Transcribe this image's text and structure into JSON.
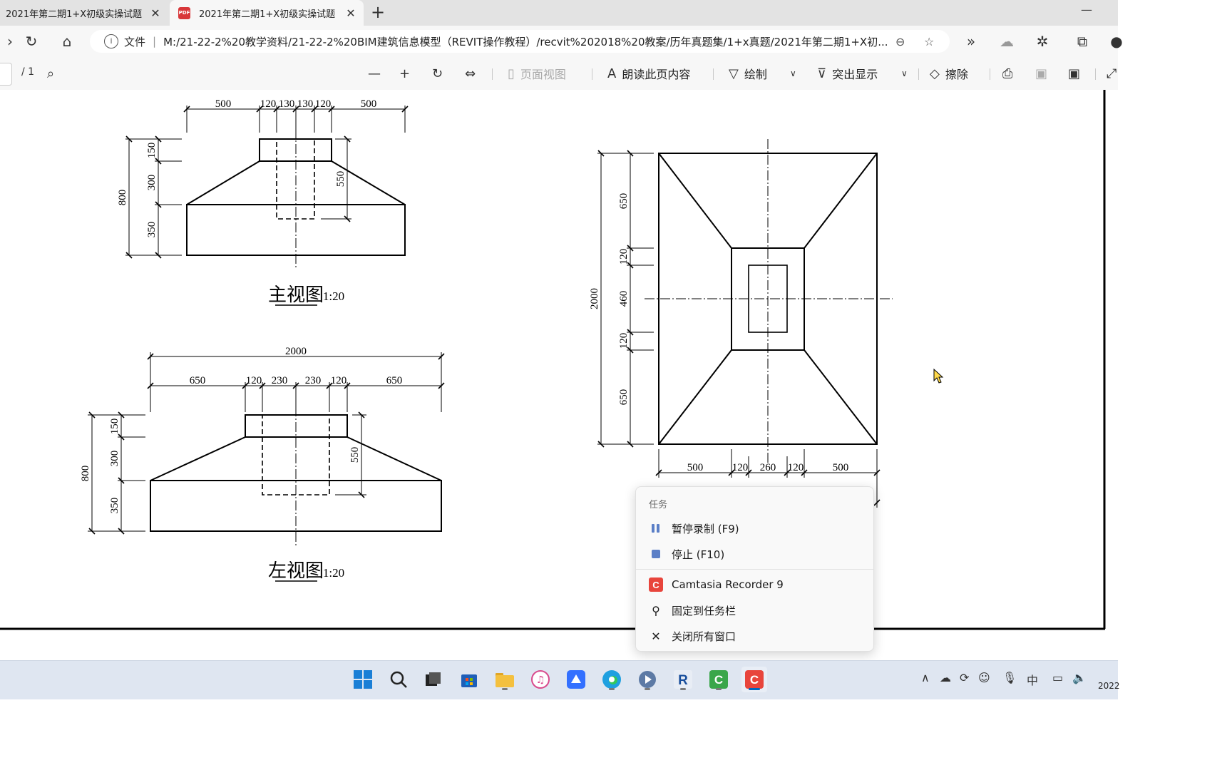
{
  "browser": {
    "tabs": [
      {
        "title": "2021年第二期1+X初级实操试题",
        "active": false
      },
      {
        "title": "2021年第二期1+X初级实操试题",
        "active": true
      }
    ],
    "new_tab_label": "+",
    "address": {
      "protocol_label": "文件",
      "url": "M:/21-22-2%20教学资料/21-22-2%20BIM建筑信息模型（REVIT操作教程）/recvit%202018%20教案/历年真题集/1+x真题/2021年第二期1+X初..."
    }
  },
  "pdf_toolbar": {
    "page_count": "/ 1",
    "page_view": "页面视图",
    "read_aloud": "朗读此页内容",
    "draw": "绘制",
    "highlight": "突出显示",
    "erase": "擦除"
  },
  "drawing": {
    "front_view": {
      "title": "主视图",
      "scale": "1:20",
      "dims_top": [
        "500",
        "120",
        "130",
        "130",
        "120",
        "500"
      ],
      "dims_left": [
        "150",
        "300",
        "350"
      ],
      "dim_total": "800",
      "dim_hidden": "550"
    },
    "side_view": {
      "title": "左视图",
      "scale": "1:20",
      "dim_overall": "2000",
      "dims_top": [
        "650",
        "120",
        "230",
        "230",
        "120",
        "650"
      ],
      "dims_left": [
        "150",
        "300",
        "350"
      ],
      "dim_total": "800",
      "dim_hidden": "550"
    },
    "plan_view": {
      "dims_left": [
        "650",
        "120",
        "460",
        "120",
        "650"
      ],
      "dim_total": "2000",
      "dims_bottom": [
        "500",
        "120",
        "260",
        "120",
        "500"
      ]
    }
  },
  "context_menu": {
    "header": "任务",
    "items": [
      {
        "label": "暂停录制 (F9)",
        "icon": "pause-icon"
      },
      {
        "label": "停止 (F10)",
        "icon": "stop-icon"
      },
      {
        "label": "Camtasia Recorder 9",
        "icon": "camtasia-icon"
      },
      {
        "label": "固定到任务栏",
        "icon": "pin-icon"
      },
      {
        "label": "关闭所有窗口",
        "icon": "close-icon"
      }
    ]
  },
  "taskbar": {
    "ime": "中",
    "clock": "2022"
  },
  "colors": {
    "tabbar_bg": "#e3e3e3",
    "toolbar_bg": "#f7f7f7",
    "taskbar_bg": "#dfe6f1",
    "pdf_badge": "#d8373a",
    "camtasia": "#e8453c",
    "accent": "#0067c0"
  }
}
